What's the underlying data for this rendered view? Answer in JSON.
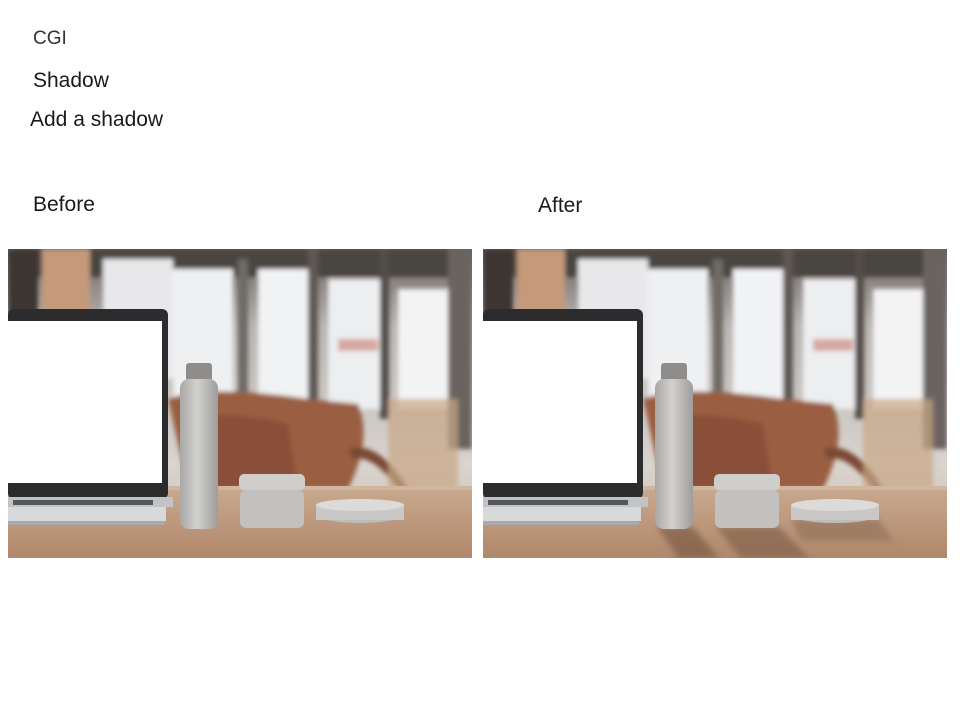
{
  "slide": {
    "category": "CGI",
    "title": "Shadow",
    "subtitle": "Add a shadow"
  },
  "comparison": {
    "before_label": "Before",
    "after_label": "After",
    "before_shows_shadow": false,
    "after_shows_shadow": true
  },
  "scene": {
    "objects": [
      "laptop",
      "bottle",
      "jar",
      "round-container"
    ],
    "colors": {
      "table": "#b58c6c",
      "chair": "#9a5e42",
      "bottle": "#c4c3c1",
      "screen": "#ffffff"
    }
  }
}
